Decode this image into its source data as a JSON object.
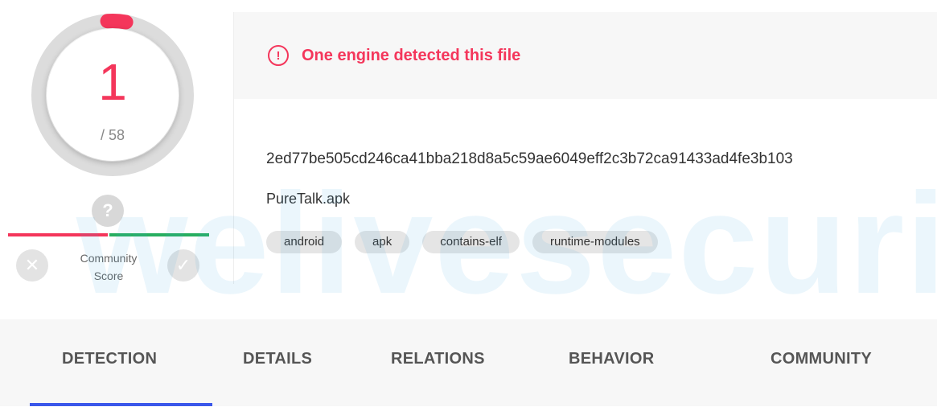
{
  "score": {
    "detected": "1",
    "total": "/ 58",
    "detected_fraction": 0.0172,
    "color": "#f4365b"
  },
  "community": {
    "question_icon": "question-icon",
    "question_glyph": "?",
    "label_line1": "Community",
    "label_line2": "Score",
    "dislike_icon": "close-icon",
    "like_icon": "check-icon",
    "negative_color": "#f4365b",
    "positive_color": "#27ae60"
  },
  "detection": {
    "alert_icon": "alert-circle-icon",
    "alert_glyph": "!",
    "message": "One engine detected this file",
    "hash": "2ed77be505cd246ca41bba218d8a5c59ae6049eff2c3b72ca91433ad4fe3b103",
    "filename": "PureTalk.apk",
    "tags": [
      "android",
      "apk",
      "contains-elf",
      "runtime-modules"
    ]
  },
  "watermark": "welivesecurity",
  "tabs": [
    {
      "label": "DETECTION",
      "active": true
    },
    {
      "label": "DETAILS",
      "active": false
    },
    {
      "label": "RELATIONS",
      "active": false
    },
    {
      "label": "BEHAVIOR",
      "active": false
    },
    {
      "label": "COMMUNITY",
      "active": false
    }
  ],
  "colors": {
    "accent_red": "#f4365b",
    "tab_active": "#3a57ea",
    "watermark": "#3ba3e2"
  }
}
